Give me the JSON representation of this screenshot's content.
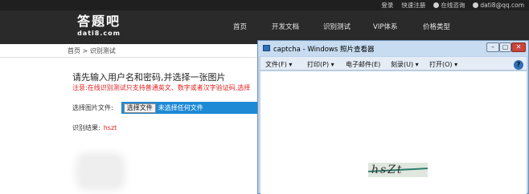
{
  "site": {
    "top_links": [
      "登录",
      "快速注册",
      "在线咨询",
      "dati8@qq.com"
    ],
    "logo": {
      "cn": "答题吧",
      "en": "dati8.com"
    },
    "nav": [
      "首页",
      "开发文档",
      "识别测试",
      "VIP体系",
      "价格类型"
    ]
  },
  "page": {
    "breadcrumb": "首页 > 识别测试",
    "heading": "请先输入用户名和密码,并选择一张图片",
    "notice": "注意:在线识别测试只支持普通英文、数字或者汉字验证码,选择",
    "file_label": "选择图片文件:",
    "file_button": "选择文件",
    "file_status": "未选择任何文件",
    "result_label": "识别结果:",
    "result_value": "hszt"
  },
  "viewer": {
    "title": "captcha - Windows 照片查看器",
    "menu": [
      "文件(F) ▾",
      "打印(P) ▾",
      "电子邮件(E)",
      "刻录(U) ▾",
      "打开(O) ▾"
    ],
    "help": "?",
    "captcha_text": "hsZt"
  },
  "colors": {
    "accent_blue": "#1e8ad6",
    "notice_red": "#e02020",
    "nav_bg": "#2a2a2a"
  }
}
